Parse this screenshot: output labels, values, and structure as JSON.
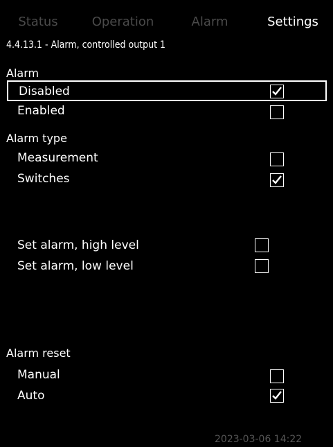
{
  "tabs": {
    "status": "Status",
    "operation": "Operation",
    "alarm": "Alarm",
    "settings": "Settings"
  },
  "page_title": "4.4.13.1 - Alarm, controlled output 1",
  "sections": {
    "alarm": {
      "title": "Alarm",
      "options": [
        {
          "label": "Disabled",
          "checked": true,
          "selected": true
        },
        {
          "label": "Enabled",
          "checked": false
        }
      ]
    },
    "alarm_type": {
      "title": "Alarm type",
      "options": [
        {
          "label": "Measurement",
          "checked": false
        },
        {
          "label": "Switches",
          "checked": true
        }
      ]
    },
    "alarm_levels": {
      "options": [
        {
          "label": "Set alarm, high level",
          "checked": false
        },
        {
          "label": "Set alarm, low level",
          "checked": false
        }
      ]
    },
    "alarm_reset": {
      "title": "Alarm reset",
      "options": [
        {
          "label": "Manual",
          "checked": false
        },
        {
          "label": "Auto",
          "checked": true
        }
      ]
    }
  },
  "footer": {
    "datetime": "2023-03-06 14:22"
  }
}
